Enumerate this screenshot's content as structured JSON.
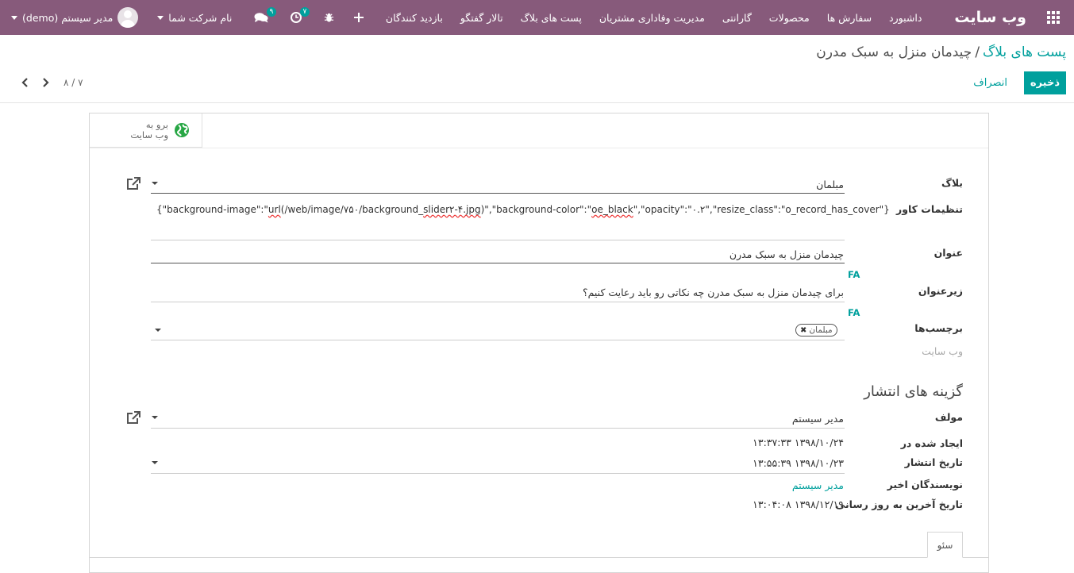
{
  "navbar": {
    "brand": "وب سایت",
    "menu": [
      "داشبورد",
      "سفارش ها",
      "محصولات",
      "گارانتی",
      "مدیریت وفاداری مشتریان",
      "پست های بلاگ",
      "تالار گفتگو",
      "بازدید کنندگان"
    ],
    "activity_count": "۷",
    "messages_count": "۹",
    "company": "نام شرکت شما",
    "user": "مدیر سیستم (demo)"
  },
  "control_panel": {
    "breadcrumb_parent": "پست های بلاگ",
    "breadcrumb_separator": "/",
    "breadcrumb_current": "چیدمان منزل به سبک مدرن",
    "save_label": "ذخیره",
    "discard_label": "انصراف",
    "pager": "۸ / ۷"
  },
  "sheet": {
    "goto_website_line1": "برو به",
    "goto_website_line2": "وب سایت",
    "fields": {
      "blog_label": "بلاگ",
      "blog_value": "مبلمان",
      "cover_label": "تنظیمات کاور",
      "cover_json_1": "{\"background-image\":\"",
      "cover_json_url": "url",
      "cover_json_2": "(/web/image/۷۵۰/background_",
      "cover_json_slider": "slider۲-۴.jpg",
      "cover_json_3": ")\",\"background-color\":\"",
      "cover_json_oe": "oe_black",
      "cover_json_4": "\",\"opacity\":\"۰.۲\",\"resize_class\":\"o_record_has_cover\"}",
      "title_label": "عنوان",
      "title_value": "چیدمان منزل به سبک مدرن",
      "subtitle_label": "زیرعنوان",
      "subtitle_value": "برای چیدمان منزل به سبک مدرن چه نکاتی رو باید رعایت کنیم؟",
      "lang": "FA",
      "tags_label": "برچسب‌ها",
      "tag_value": "مبلمان",
      "website_label": "وب سایت"
    },
    "publishing": {
      "section_title": "گزینه های انتشار",
      "author_label": "مولف",
      "author_value": "مدیر سیستم",
      "created_label": "ایجاد شده در",
      "created_value": "۱۳۹۸/۱۰/۲۴ ۱۳:۳۷:۳۳",
      "published_label": "تاریخ انتشار",
      "published_value": "۱۳۹۸/۱۰/۲۳ ۱۳:۵۵:۳۹",
      "last_writers_label": "نویسندگان اخیر",
      "last_writers_value": "مدیر سیستم",
      "last_update_label": "تاریخ آخرین به روز رسانی",
      "last_update_value": "۱۳۹۸/۱۲/۱۹ ۱۳:۰۴:۰۸"
    },
    "tab_seo": "سئو"
  },
  "colors": {
    "navbar": "#875a7b",
    "accent": "#00a09d"
  }
}
